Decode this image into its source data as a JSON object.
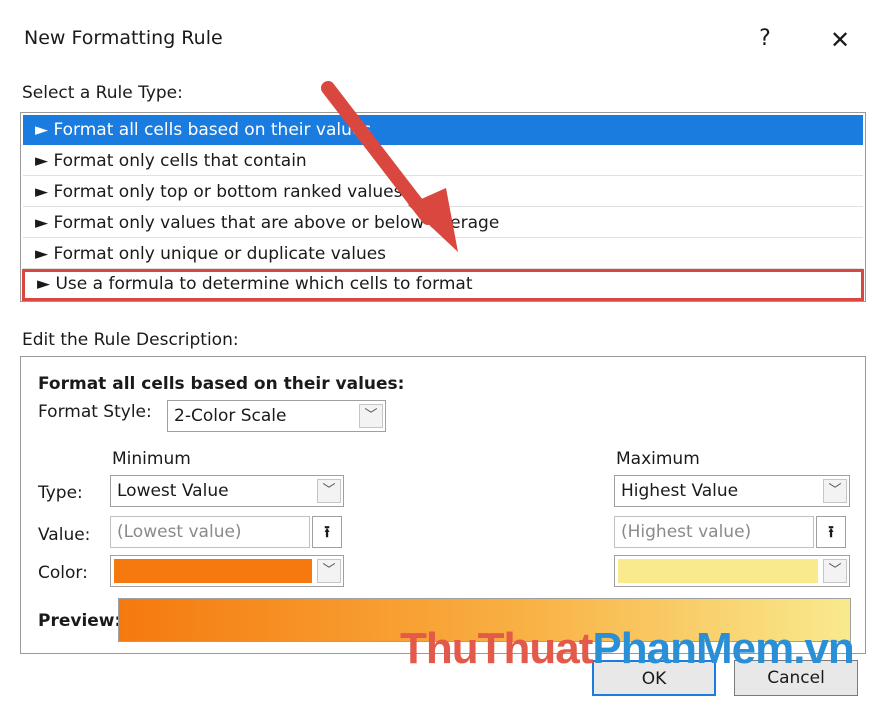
{
  "dialog": {
    "title": "New Formatting Rule",
    "help_label": "?",
    "close_label": "✕"
  },
  "rule_type": {
    "label": "Select a Rule Type:",
    "items": [
      {
        "label": "Format all cells based on their values"
      },
      {
        "label": "Format only cells that contain"
      },
      {
        "label": "Format only top or bottom ranked values"
      },
      {
        "label": "Format only values that are above or below average"
      },
      {
        "label": "Format only unique or duplicate values"
      },
      {
        "label": "Use a formula to determine which cells to format"
      }
    ],
    "bullet": "►",
    "selected_index": 0,
    "highlighted_index": 5
  },
  "description": {
    "label": "Edit the Rule Description:",
    "heading": "Format all cells based on their values:",
    "format_style_label": "Format Style:",
    "format_style_value": "2-Color Scale",
    "minimum_label": "Minimum",
    "maximum_label": "Maximum",
    "type_label": "Type:",
    "value_label": "Value:",
    "color_label": "Color:",
    "min_type": "Lowest Value",
    "max_type": "Highest Value",
    "min_value_placeholder": "(Lowest value)",
    "max_value_placeholder": "(Highest value)",
    "min_color": "#f5790e",
    "max_color": "#f9ea8e",
    "preview_label": "Preview:"
  },
  "buttons": {
    "ok": "OK",
    "cancel": "Cancel"
  },
  "watermark": {
    "part1": "ThuThuat",
    "part2": "PhanMem",
    "part3": ".vn"
  },
  "colors": {
    "selection": "#1b7ce0",
    "highlight_border": "#d9473f",
    "arrow": "#d9473f"
  }
}
